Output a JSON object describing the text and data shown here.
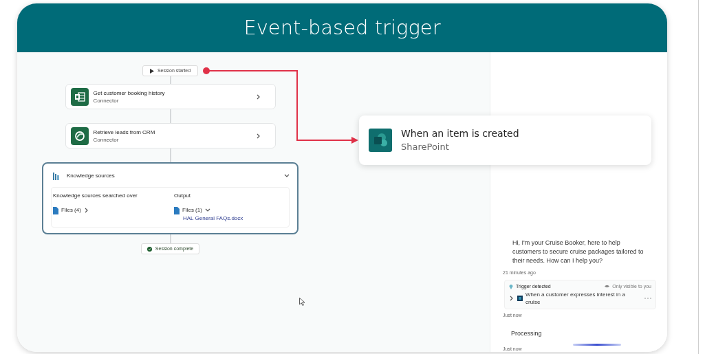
{
  "header": {
    "title": "Event-based trigger"
  },
  "flow": {
    "start": {
      "label": "Session started"
    },
    "steps": [
      {
        "title": "Get customer booking history",
        "subtitle": "Connector",
        "kind": "excel"
      },
      {
        "title": "Retrieve leads from CRM",
        "subtitle": "Connector",
        "kind": "dataverse"
      }
    ],
    "knowledge": {
      "title": "Knowledge sources",
      "expanded": true,
      "searched_label": "Knowledge sources searched over",
      "searched_files": "Files (4)",
      "output_label": "Output",
      "output_files": "Files (1)",
      "output_items": [
        "HAL General FAQs.docx"
      ]
    },
    "end": {
      "label": "Session complete"
    }
  },
  "trigger_card": {
    "title": "When an item is created",
    "subtitle": "SharePoint"
  },
  "chat": {
    "greeting": "Hi, I'm your Cruise Booker, here to help customers to secure cruise packages tailored to their needs. How can I help you?",
    "greeting_time": "21 minutes ago",
    "trigger": {
      "title": "Trigger detected",
      "visibility": "Only visible to you",
      "text": "When a customer expresses interest in a cruise",
      "time": "Just now"
    },
    "status": "Processing",
    "status_time": "Just now"
  }
}
